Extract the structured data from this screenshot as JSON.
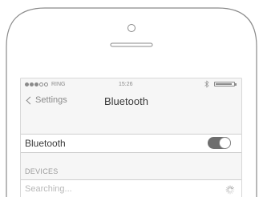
{
  "status_bar": {
    "signal_full": 3,
    "signal_empty": 2,
    "carrier": "RING",
    "time": "15:26",
    "bluetooth_icon": "bluetooth-icon",
    "battery_level": 0.92
  },
  "nav": {
    "back_label": "Settings",
    "title": "Bluetooth"
  },
  "bluetooth_row": {
    "label": "Bluetooth",
    "toggle_on": true
  },
  "devices": {
    "header": "DEVICES",
    "status": "Searching..."
  },
  "colors": {
    "outline": "#8a8a8a",
    "screen_bg": "#f6f6f6",
    "toggle_on": "#6e6e6e",
    "divider": "#cfcfcf"
  }
}
